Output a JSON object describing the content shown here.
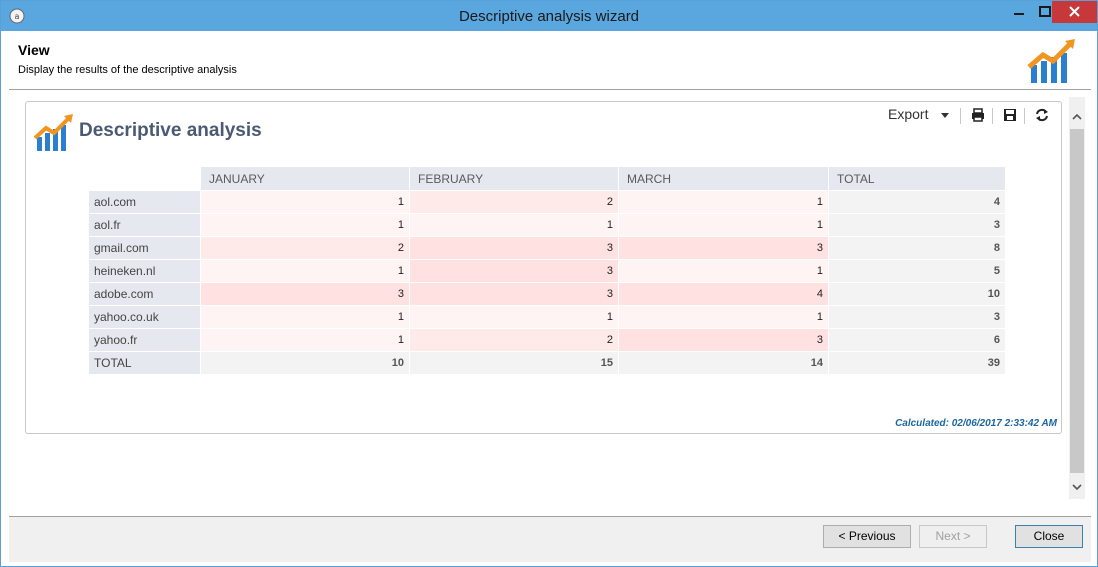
{
  "window": {
    "title": "Descriptive analysis wizard"
  },
  "header": {
    "title": "View",
    "subtitle": "Display the results of the descriptive analysis"
  },
  "panel": {
    "title": "Descriptive analysis",
    "export_label": "Export",
    "calculated": "Calculated: 02/06/2017 2:33:42 AM"
  },
  "table": {
    "columns": [
      "JANUARY",
      "FEBRUARY",
      "MARCH",
      "TOTAL"
    ],
    "rows": [
      {
        "label": "aol.com",
        "values": [
          "1",
          "2",
          "1"
        ],
        "total": "4"
      },
      {
        "label": "aol.fr",
        "values": [
          "1",
          "1",
          "1"
        ],
        "total": "3"
      },
      {
        "label": "gmail.com",
        "values": [
          "2",
          "3",
          "3"
        ],
        "total": "8"
      },
      {
        "label": "heineken.nl",
        "values": [
          "1",
          "3",
          "1"
        ],
        "total": "5"
      },
      {
        "label": "adobe.com",
        "values": [
          "3",
          "3",
          "4"
        ],
        "total": "10"
      },
      {
        "label": "yahoo.co.uk",
        "values": [
          "1",
          "1",
          "1"
        ],
        "total": "3"
      },
      {
        "label": "yahoo.fr",
        "values": [
          "1",
          "2",
          "3"
        ],
        "total": "6"
      }
    ],
    "total_row": {
      "label": "TOTAL",
      "values": [
        "10",
        "15",
        "14"
      ],
      "total": "39"
    }
  },
  "buttons": {
    "previous": "< Previous",
    "next": "Next >",
    "close": "Close"
  },
  "colors": {
    "titlebar": "#5aa6df",
    "close_button": "#c7383a",
    "heat_low": "#fff4f4",
    "heat_high": "#ffe1e1",
    "header_cell": "#e6e8f0",
    "calculated_text": "#1b67a0"
  }
}
